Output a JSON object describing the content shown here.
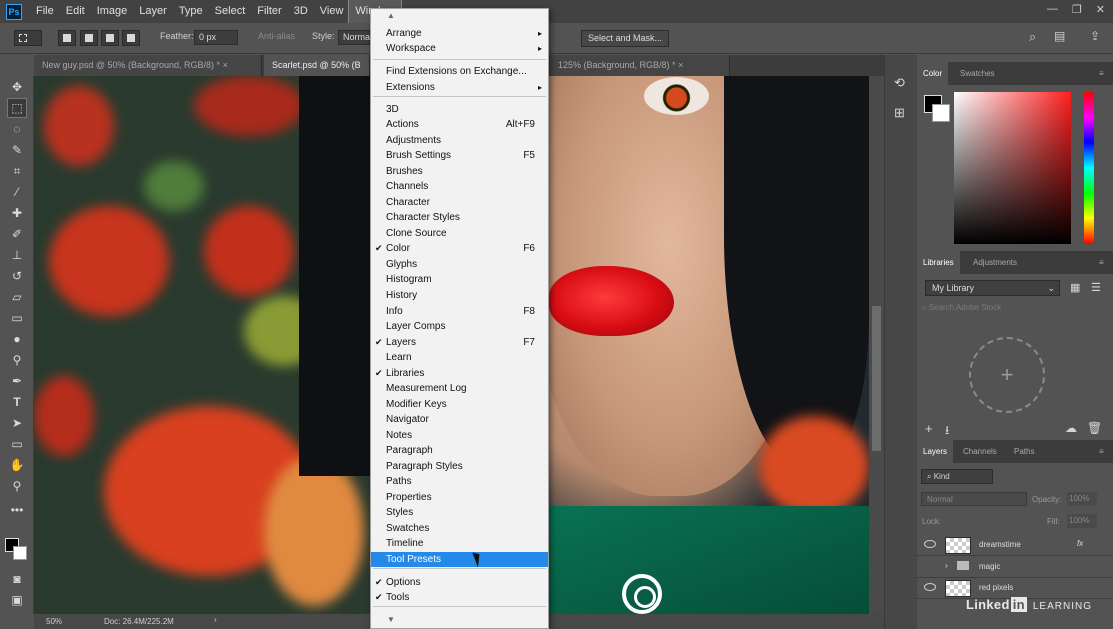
{
  "menubar": {
    "logo": "Ps",
    "items": [
      "File",
      "Edit",
      "Image",
      "Layer",
      "Type",
      "Select",
      "Filter",
      "3D",
      "View",
      "Window"
    ],
    "active": "Window",
    "window_controls": [
      "—",
      "❐",
      "✕"
    ]
  },
  "options": {
    "feather_label": "Feather:",
    "feather_value": "0 px",
    "anti_alias": "Anti-alias",
    "style_label": "Style:",
    "style_value": "Normal",
    "mask_button": "Select and Mask..."
  },
  "tabs": [
    {
      "label": "New guy.psd @ 50% (Background, RGB/8) *"
    },
    {
      "label": "Scarlet.psd @ 50% (B"
    },
    {
      "label": "125% (Background, RGB/8) *"
    }
  ],
  "status": {
    "zoom": "50%",
    "doc": "Doc: 26.4M/225.2M"
  },
  "color_panel": {
    "tabs": [
      "Color",
      "Swatches"
    ],
    "foreground": "#000000",
    "background": "#ffffff",
    "hue": "#ff1f1f"
  },
  "libraries_panel": {
    "tabs": [
      "Libraries",
      "Adjustments"
    ],
    "library": "My Library",
    "search_placeholder": "Search Adobe Stock"
  },
  "layers_panel": {
    "tabs": [
      "Layers",
      "Channels",
      "Paths"
    ],
    "filter": "Kind",
    "blend_mode": "Normal",
    "opacity_label": "Opacity:",
    "opacity_value": "100%",
    "lock_label": "Lock:",
    "fill_label": "Fill:",
    "fill_value": "100%",
    "layers": [
      {
        "name": "dreamstime",
        "fx": "fx"
      },
      {
        "name": "magic",
        "fx": ""
      },
      {
        "name": "red pixels",
        "fx": ""
      }
    ]
  },
  "window_menu": {
    "items": [
      {
        "label": "Arrange",
        "shortcut": "",
        "check": "",
        "submenu": "▸"
      },
      {
        "label": "Workspace",
        "shortcut": "",
        "check": "",
        "submenu": "▸"
      },
      {
        "label": "Find Extensions on Exchange...",
        "shortcut": "",
        "check": "",
        "submenu": ""
      },
      {
        "label": "Extensions",
        "shortcut": "",
        "check": "",
        "submenu": "▸"
      },
      {
        "label": "3D",
        "shortcut": "",
        "check": "",
        "submenu": ""
      },
      {
        "label": "Actions",
        "shortcut": "Alt+F9",
        "check": "",
        "submenu": ""
      },
      {
        "label": "Adjustments",
        "shortcut": "",
        "check": "",
        "submenu": ""
      },
      {
        "label": "Brush Settings",
        "shortcut": "F5",
        "check": "",
        "submenu": ""
      },
      {
        "label": "Brushes",
        "shortcut": "",
        "check": "",
        "submenu": ""
      },
      {
        "label": "Channels",
        "shortcut": "",
        "check": "",
        "submenu": ""
      },
      {
        "label": "Character",
        "shortcut": "",
        "check": "",
        "submenu": ""
      },
      {
        "label": "Character Styles",
        "shortcut": "",
        "check": "",
        "submenu": ""
      },
      {
        "label": "Clone Source",
        "shortcut": "",
        "check": "",
        "submenu": ""
      },
      {
        "label": "Color",
        "shortcut": "F6",
        "check": "✔",
        "submenu": ""
      },
      {
        "label": "Glyphs",
        "shortcut": "",
        "check": "",
        "submenu": ""
      },
      {
        "label": "Histogram",
        "shortcut": "",
        "check": "",
        "submenu": ""
      },
      {
        "label": "History",
        "shortcut": "",
        "check": "",
        "submenu": ""
      },
      {
        "label": "Info",
        "shortcut": "F8",
        "check": "",
        "submenu": ""
      },
      {
        "label": "Layer Comps",
        "shortcut": "",
        "check": "",
        "submenu": ""
      },
      {
        "label": "Layers",
        "shortcut": "F7",
        "check": "✔",
        "submenu": ""
      },
      {
        "label": "Learn",
        "shortcut": "",
        "check": "",
        "submenu": ""
      },
      {
        "label": "Libraries",
        "shortcut": "",
        "check": "✔",
        "submenu": ""
      },
      {
        "label": "Measurement Log",
        "shortcut": "",
        "check": "",
        "submenu": ""
      },
      {
        "label": "Modifier Keys",
        "shortcut": "",
        "check": "",
        "submenu": ""
      },
      {
        "label": "Navigator",
        "shortcut": "",
        "check": "",
        "submenu": ""
      },
      {
        "label": "Notes",
        "shortcut": "",
        "check": "",
        "submenu": ""
      },
      {
        "label": "Paragraph",
        "shortcut": "",
        "check": "",
        "submenu": ""
      },
      {
        "label": "Paragraph Styles",
        "shortcut": "",
        "check": "",
        "submenu": ""
      },
      {
        "label": "Paths",
        "shortcut": "",
        "check": "",
        "submenu": ""
      },
      {
        "label": "Properties",
        "shortcut": "",
        "check": "",
        "submenu": ""
      },
      {
        "label": "Styles",
        "shortcut": "",
        "check": "",
        "submenu": ""
      },
      {
        "label": "Swatches",
        "shortcut": "",
        "check": "",
        "submenu": ""
      },
      {
        "label": "Timeline",
        "shortcut": "",
        "check": "",
        "submenu": ""
      },
      {
        "label": "Tool Presets",
        "shortcut": "",
        "check": "",
        "submenu": ""
      },
      {
        "label": "Options",
        "shortcut": "",
        "check": "✔",
        "submenu": ""
      },
      {
        "label": "Tools",
        "shortcut": "",
        "check": "✔",
        "submenu": ""
      }
    ],
    "highlighted": "Tool Presets"
  },
  "watermark": {
    "linked": "Linked",
    "in": "in",
    "learning": "LEARNING"
  }
}
